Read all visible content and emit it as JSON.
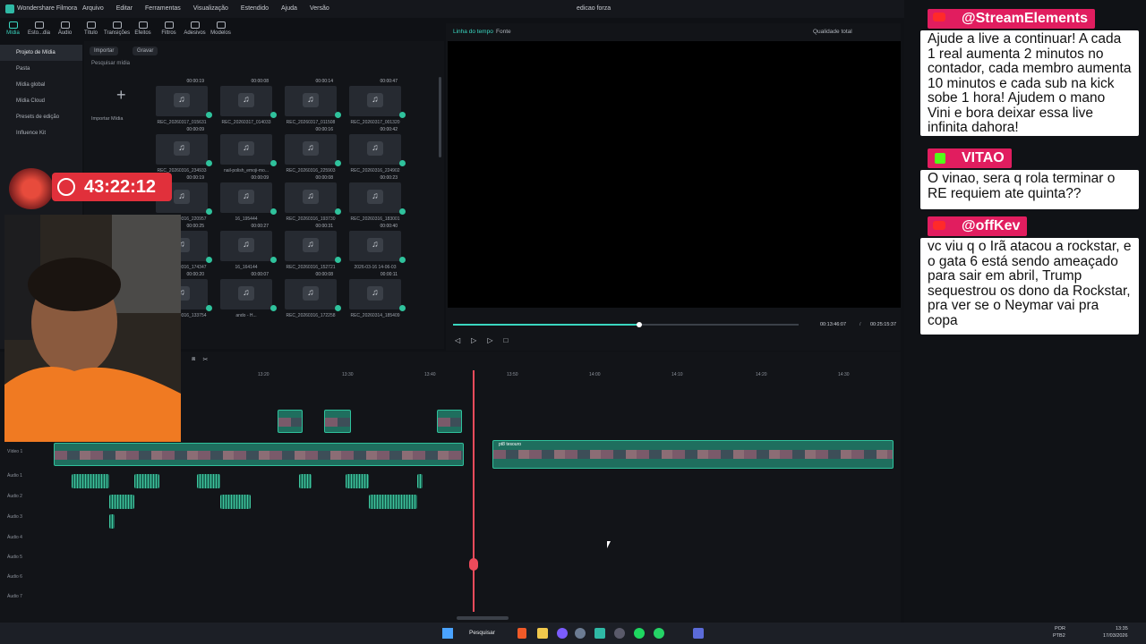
{
  "titlebar": {
    "app_name": "Wondershare Filmora",
    "menu": [
      "Arquivo",
      "Editar",
      "Ferramentas",
      "Visualização",
      "Estendido",
      "Ajuda",
      "Versão"
    ],
    "project_name": "edicao forza"
  },
  "top_tabs": [
    {
      "label": "Mídia",
      "active": true
    },
    {
      "label": "Esto...dia"
    },
    {
      "label": "Áudio"
    },
    {
      "label": "Título"
    },
    {
      "label": "Transições"
    },
    {
      "label": "Efeitos"
    },
    {
      "label": "Filtros"
    },
    {
      "label": "Adesivos"
    },
    {
      "label": "Modelos"
    }
  ],
  "sidebar": [
    {
      "label": "Projeto de Mídia",
      "active": true
    },
    {
      "label": "Pasta"
    },
    {
      "label": "Mídia global"
    },
    {
      "label": "Mídia Cloud"
    },
    {
      "label": "Presets de edição"
    },
    {
      "label": "Influence Kit"
    }
  ],
  "media": {
    "import_label": "Importar",
    "record_label": "Gravar",
    "search_placeholder": "Pesquisar mídia",
    "import_media_label": "Importar Mídia",
    "items": [
      {
        "name": "REC_20260317_015631",
        "dur": "00:00:19"
      },
      {
        "name": "REC_20260317_014033",
        "dur": "00:00:08"
      },
      {
        "name": "REC_20260317_011508",
        "dur": "00:00:14"
      },
      {
        "name": "REC_20260317_001320",
        "dur": "00:00:47"
      },
      {
        "name": "REC_20260316_234933",
        "dur": "00:00:09"
      },
      {
        "name": "nail-polish_emoji-mo...",
        "dur": ""
      },
      {
        "name": "REC_20260316_225903",
        "dur": "00:00:16"
      },
      {
        "name": "REC_20260316_224902",
        "dur": "00:00:42"
      },
      {
        "name": "REC_20260316_220957",
        "dur": "00:00:19"
      },
      {
        "name": "16_195444",
        "dur": "00:00:09"
      },
      {
        "name": "REC_20260316_193730",
        "dur": "00:00:08"
      },
      {
        "name": "REC_20260316_183001",
        "dur": "00:00:23"
      },
      {
        "name": "REC_20260316_174347",
        "dur": "00:00:25"
      },
      {
        "name": "16_164144",
        "dur": "00:00:27"
      },
      {
        "name": "REC_20260316_152721",
        "dur": "00:00:31"
      },
      {
        "name": "2026-03-16 14-06-03",
        "dur": "00:00:40"
      },
      {
        "name": "REC_20260316_133754",
        "dur": "00:00:20"
      },
      {
        "name": "ando - H...",
        "dur": "00:00:07"
      },
      {
        "name": "REC_20260316_172258",
        "dur": "00:00:08"
      },
      {
        "name": "REC_20260314_185409",
        "dur": "00:00:11"
      },
      {
        "name": "REC_20260314_164719",
        "dur": "00:00:13"
      }
    ]
  },
  "preview": {
    "timeline_tab": "Linha do tempo",
    "source_tab": "Fonte",
    "quality": "Qualidade total",
    "current_time": "00:13:46:07",
    "separator": "/",
    "total_time": "00:25:15:37",
    "progress": 0.54
  },
  "timeline": {
    "ruler": [
      "13:20",
      "13:30",
      "13:40",
      "13:50",
      "14:00",
      "14:10",
      "14:20",
      "14:30"
    ],
    "tracks": [
      "Vídeo 1",
      "Áudio 1",
      "Áudio 2",
      "Áudio 3",
      "Áudio 4",
      "Áudio 5",
      "Áudio 6",
      "Áudio 7"
    ],
    "clip_label": "pt8 tesouro"
  },
  "stream_overlay": {
    "timer": "43:22:12"
  },
  "chat": [
    {
      "user": "@StreamElements",
      "head_color": "#e11d5f",
      "message": "Ajude a live a continuar! A cada 1 real aumenta 2 minutos no contador, cada membro aumenta 10 minutos e cada sub na kick sobe 1 hora! Ajudem o mano Vini e bora deixar essa live infinita dahora!"
    },
    {
      "user": "VITAO",
      "head_color": "#e11d5f",
      "message": "O vinao, sera q rola terminar o RE requiem ate quinta??"
    },
    {
      "user": "@offKev",
      "head_color": "#e11d5f",
      "message": "vc viu q o Irã atacou a rockstar, e o gata 6 está sendo ameaçado para sair em abril, Trump sequestrou os dono da Rockstar, pra ver se o Neymar vai pra copa"
    }
  ],
  "taskbar": {
    "search": "Pesquisar",
    "lang": "POR",
    "kbd": "PTB2",
    "time": "13:35",
    "date": "17/03/2026"
  }
}
